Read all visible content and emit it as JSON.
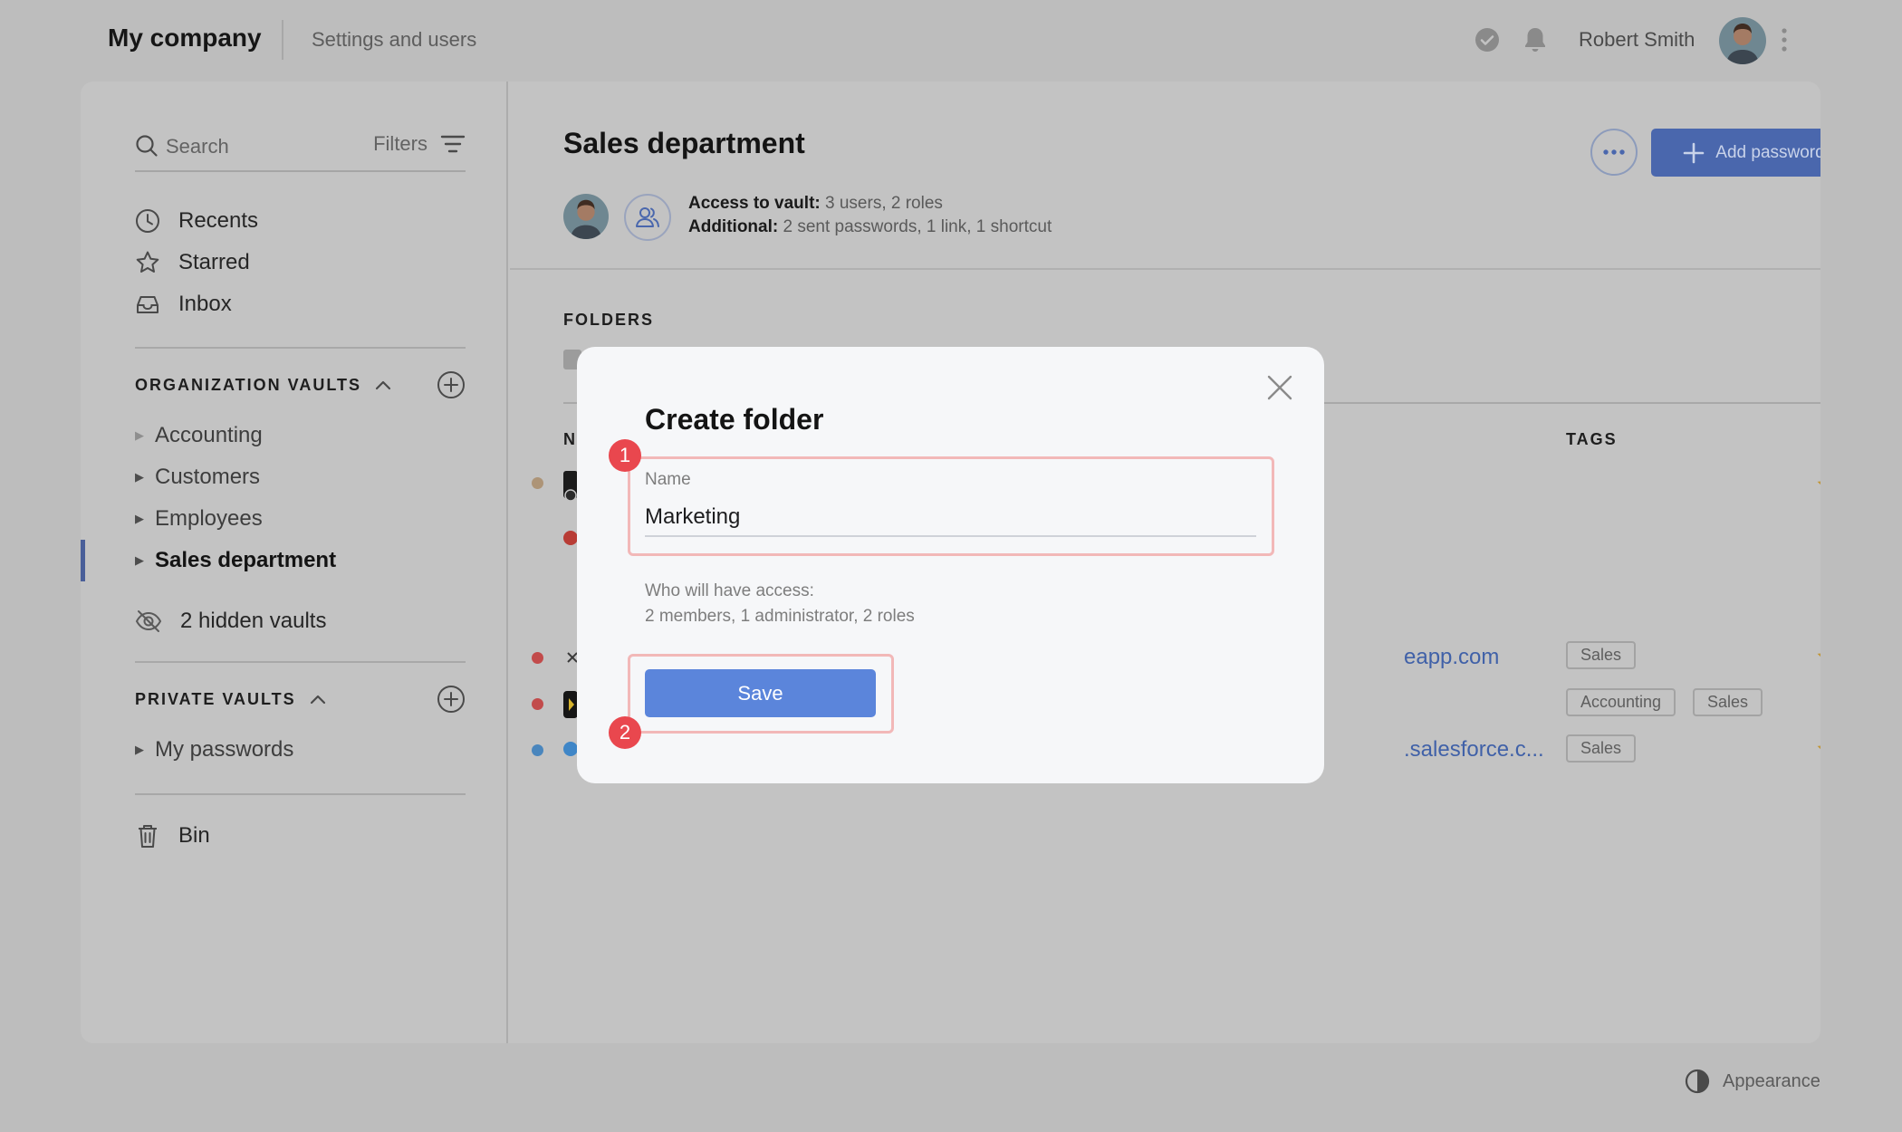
{
  "header": {
    "company": "My company",
    "settings_link": "Settings and users",
    "user_name": "Robert Smith"
  },
  "sidebar": {
    "search_placeholder": "Search",
    "filters_label": "Filters",
    "nav": [
      {
        "label": "Recents",
        "icon": "clock-icon"
      },
      {
        "label": "Starred",
        "icon": "star-icon"
      },
      {
        "label": "Inbox",
        "icon": "inbox-icon"
      }
    ],
    "org_vaults": {
      "title": "ORGANIZATION VAULTS",
      "items": [
        {
          "label": "Accounting"
        },
        {
          "label": "Customers"
        },
        {
          "label": "Employees"
        },
        {
          "label": "Sales department",
          "active": true
        }
      ],
      "hidden": "2 hidden vaults"
    },
    "private_vaults": {
      "title": "PRIVATE VAULTS",
      "items": [
        {
          "label": "My passwords"
        }
      ]
    },
    "bin": "Bin"
  },
  "content": {
    "title": "Sales department",
    "add_button": "Add password",
    "access_label": "Access to vault:",
    "access_value": "3 users, 2 roles",
    "additional_label": "Additional:",
    "additional_value": "2 sent passwords, 1 link, 1 shortcut",
    "folders_label": "FOLDERS",
    "columns": {
      "name": "N",
      "tags": "TAGS"
    },
    "rows": [
      {
        "dot_color": "#ad9477",
        "link": "",
        "tags": [],
        "starred": true
      },
      {
        "dot_color": "#c24b4b",
        "link": "eapp.com",
        "tags": [
          "Sales"
        ],
        "starred": true
      },
      {
        "dot_color": "#c24b4b",
        "link": "",
        "tags": [
          "Accounting",
          "Sales"
        ],
        "starred": false
      },
      {
        "dot_color": "#4a86bd",
        "link": ".salesforce.c...",
        "tags": [
          "Sales"
        ],
        "starred": true
      }
    ]
  },
  "footer": {
    "appearance": "Appearance"
  },
  "modal": {
    "title": "Create folder",
    "name_label": "Name",
    "name_value": "Marketing",
    "access_line1": "Who will have access:",
    "access_line2": "2 members, 1 administrator, 2 roles",
    "save_label": "Save",
    "badge1": "1",
    "badge2": "2"
  },
  "colors": {
    "accent": "#5b85db",
    "highlight_border": "#f2b8b8",
    "badge": "#e9474e",
    "star": "#c1973a"
  }
}
